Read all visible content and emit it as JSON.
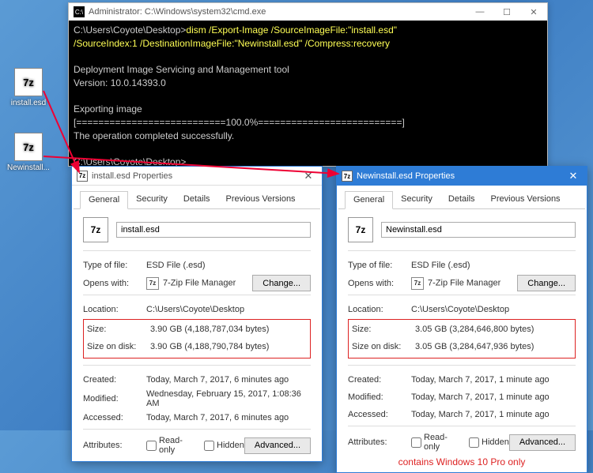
{
  "desktop": {
    "icons": [
      {
        "label": "install.esd",
        "glyph": "7z"
      },
      {
        "label": "Newinstall...",
        "glyph": "7z"
      }
    ]
  },
  "cmd": {
    "title": "Administrator: C:\\Windows\\system32\\cmd.exe",
    "controls": {
      "min": "—",
      "max": "☐",
      "close": "✕"
    },
    "prompt1": "C:\\Users\\Coyote\\Desktop>",
    "command": "dism /Export-Image /SourceImageFile:\"install.esd\"\n/SourceIndex:1 /DestinationImageFile:\"Newinstall.esd\" /Compress:recovery",
    "out1": "Deployment Image Servicing and Management tool",
    "out2": "Version: 10.0.14393.0",
    "out3": "Exporting image",
    "out4": "[===========================100.0%==========================]",
    "out5": "The operation completed successfully.",
    "prompt2": "C:\\Users\\Coyote\\Desktop>"
  },
  "tabs": {
    "general": "General",
    "security": "Security",
    "details": "Details",
    "prev": "Previous Versions"
  },
  "labels": {
    "typeoffile": "Type of file:",
    "openswith": "Opens with:",
    "change": "Change...",
    "location": "Location:",
    "size": "Size:",
    "sizeondisk": "Size on disk:",
    "created": "Created:",
    "modified": "Modified:",
    "accessed": "Accessed:",
    "attributes": "Attributes:",
    "readonly": "Read-only",
    "hidden": "Hidden",
    "advanced": "Advanced...",
    "sevenzip": "7-Zip File Manager",
    "esd": "ESD File (.esd)"
  },
  "left": {
    "title": "install.esd Properties",
    "filename": "install.esd",
    "location": "C:\\Users\\Coyote\\Desktop",
    "size": "3.90 GB (4,188,787,034 bytes)",
    "sizeondisk": "3.90 GB (4,188,790,784 bytes)",
    "created": "Today, March 7, 2017, 6 minutes ago",
    "modified": "Wednesday, February 15, 2017, 1:08:36 AM",
    "accessed": "Today, March 7, 2017, 6 minutes ago"
  },
  "right": {
    "title": "Newinstall.esd Properties",
    "filename": "Newinstall.esd",
    "location": "C:\\Users\\Coyote\\Desktop",
    "size": "3.05 GB (3,284,646,800 bytes)",
    "sizeondisk": "3.05 GB (3,284,647,936 bytes)",
    "created": "Today, March 7, 2017, 1 minute ago",
    "modified": "Today, March 7, 2017, 1 minute ago",
    "accessed": "Today, March 7, 2017, 1 minute ago",
    "annotation": "contains Windows 10 Pro only"
  }
}
